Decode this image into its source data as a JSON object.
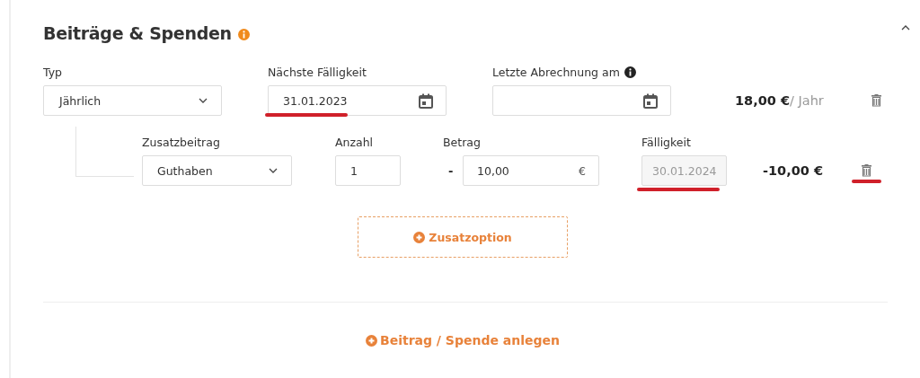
{
  "section": {
    "title": "Beiträge & Spenden"
  },
  "main_row": {
    "fields": [
      {
        "kind": "select",
        "label": "Typ",
        "value": "Jährlich"
      },
      {
        "kind": "date",
        "label": "Nächste Fälligkeit",
        "value": "31.01.2023",
        "marked": true
      },
      {
        "kind": "date",
        "label": "Letzte Abrechnung am",
        "info": true
      }
    ],
    "amount": "18,00 €",
    "period": "/ Jahr"
  },
  "extra_rows": [
    {
      "fields": [
        {
          "kind": "select",
          "label": "Zusatzbeitrag",
          "value": "Guthaben"
        },
        {
          "kind": "number",
          "label": "Anzahl",
          "value": "1"
        },
        {
          "kind": "money",
          "label": "Betrag",
          "sign": "-",
          "value": "10,00",
          "unit": "€"
        },
        {
          "kind": "date",
          "label": "Fälligkeit",
          "value": "30.01.2024",
          "disabled": true,
          "marked": true
        }
      ],
      "amount": "-10,00 €",
      "delete_marked": true
    }
  ],
  "add_option": "Zusatzoption",
  "add_entry": "Beitrag / Spende anlegen"
}
